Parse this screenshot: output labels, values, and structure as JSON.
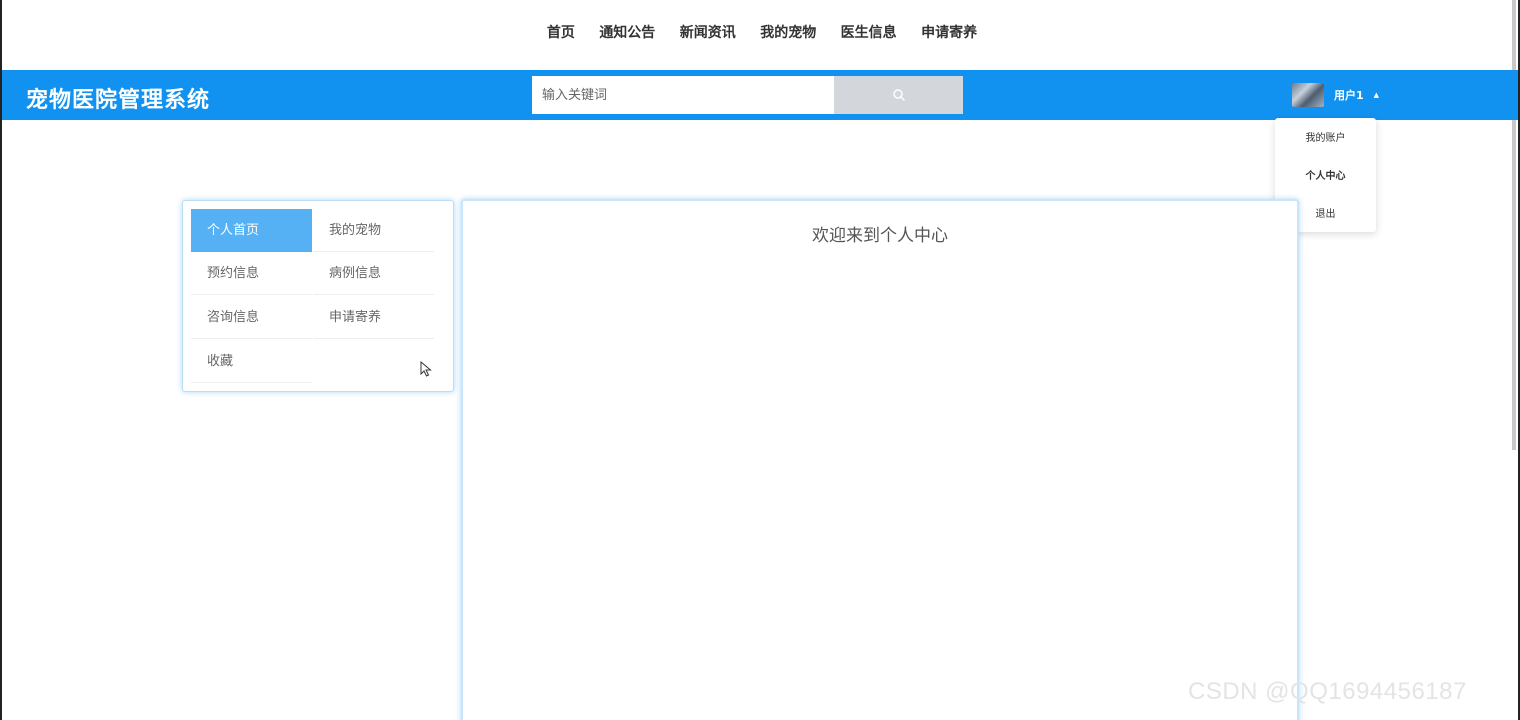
{
  "top_nav": [
    "首页",
    "通知公告",
    "新闻资讯",
    "我的宠物",
    "医生信息",
    "申请寄养"
  ],
  "header": {
    "brand": "宠物医院管理系统",
    "search_placeholder": "输入关键词",
    "user_name": "用户1"
  },
  "user_menu": [
    "我的账户",
    "个人中心",
    "退出"
  ],
  "side_menu": [
    {
      "label": "个人首页",
      "active": true
    },
    {
      "label": "我的宠物",
      "active": false
    },
    {
      "label": "预约信息",
      "active": false
    },
    {
      "label": "病例信息",
      "active": false
    },
    {
      "label": "咨询信息",
      "active": false
    },
    {
      "label": "申请寄养",
      "active": false
    },
    {
      "label": "收藏",
      "active": false
    }
  ],
  "main": {
    "welcome": "欢迎来到个人中心"
  },
  "watermark": "CSDN @QQ1694456187",
  "colors": {
    "primary": "#1292f0",
    "active_menu": "#55b1f3",
    "search_button": "#d3d6da"
  },
  "icons": {
    "search": "search-icon",
    "caret": "caret-up-icon",
    "cursor": "mouse-pointer-icon"
  }
}
